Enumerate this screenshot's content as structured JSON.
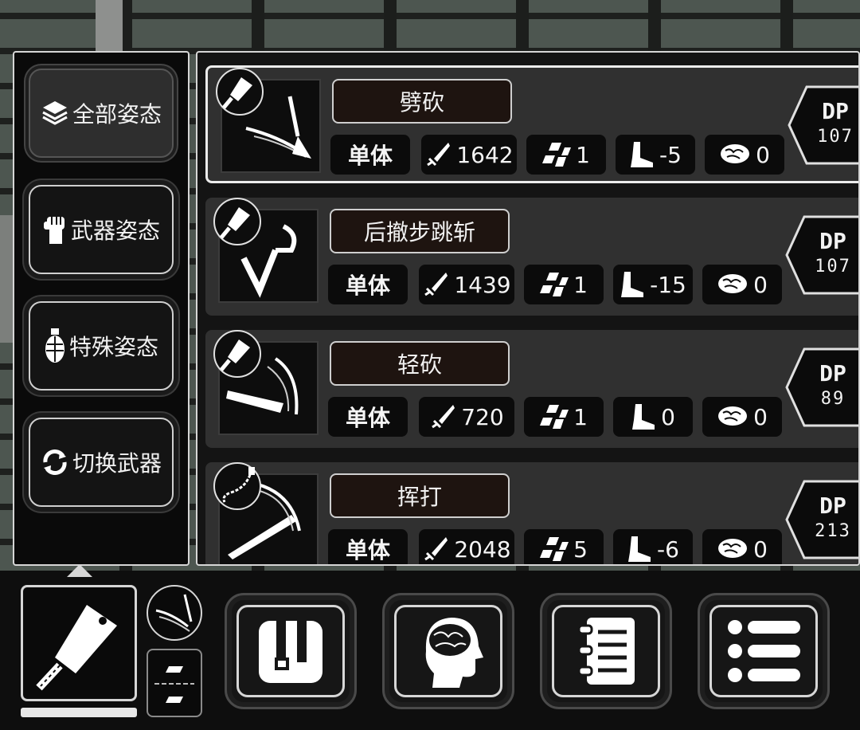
{
  "stances": [
    {
      "label": "全部姿态",
      "icon": "layers-icon"
    },
    {
      "label": "武器姿态",
      "icon": "fist-icon"
    },
    {
      "label": "特殊姿态",
      "icon": "grenade-icon"
    },
    {
      "label": "切换武器",
      "icon": "swap-icon"
    }
  ],
  "skills": [
    {
      "name": "劈砍",
      "target": "单体",
      "attack": "1642",
      "hit": "1",
      "move": "-5",
      "mind": "0",
      "dp_label": "DP",
      "dp": "107"
    },
    {
      "name": "后撤步跳斩",
      "target": "单体",
      "attack": "1439",
      "hit": "1",
      "move": "-15",
      "mind": "0",
      "dp_label": "DP",
      "dp": "107"
    },
    {
      "name": "轻砍",
      "target": "单体",
      "attack": "720",
      "hit": "1",
      "move": "0",
      "mind": "0",
      "dp_label": "DP",
      "dp": "89"
    },
    {
      "name": "挥打",
      "target": "单体",
      "attack": "2048",
      "hit": "5",
      "move": "-6",
      "mind": "0",
      "dp_label": "DP",
      "dp": "213"
    }
  ],
  "bottom_menu": [
    "backpack-icon",
    "brain-head-icon",
    "notebook-icon",
    "list-menu-icon"
  ],
  "weapon": {
    "icon": "cleaver-icon",
    "durability": 1.0
  }
}
